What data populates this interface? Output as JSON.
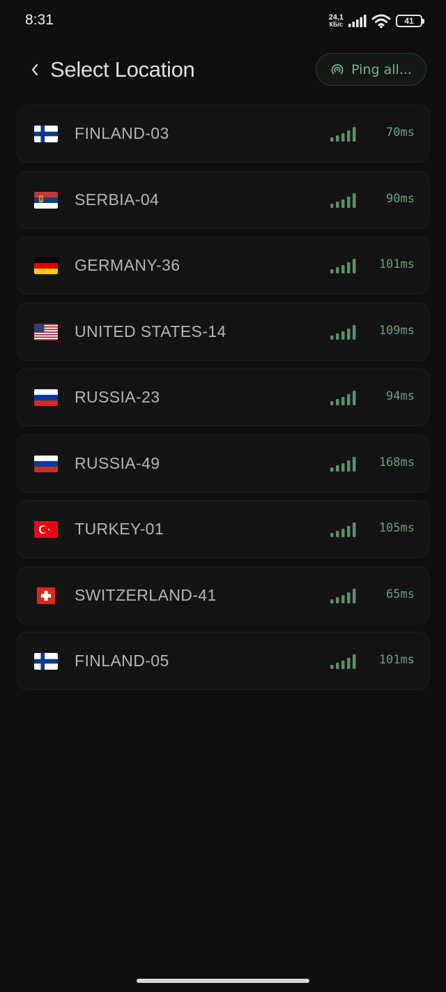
{
  "status_bar": {
    "time": "8:31",
    "net_speed_value": "24,1",
    "net_speed_unit": "КБ/с",
    "battery": "41",
    "icons": [
      "signal-icon",
      "wifi-icon",
      "battery-icon"
    ]
  },
  "header": {
    "title": "Select Location",
    "ping_all_label": "Ping all..."
  },
  "colors": {
    "background": "#0f0f0f",
    "row_background": "#141414",
    "accent_green": "#6f9e7c"
  },
  "locations": [
    {
      "name": "FINLAND-03",
      "ping": "70ms",
      "flag": "FI",
      "signal_bars": 5
    },
    {
      "name": "SERBIA-04",
      "ping": "90ms",
      "flag": "RS",
      "signal_bars": 5
    },
    {
      "name": "GERMANY-36",
      "ping": "101ms",
      "flag": "DE",
      "signal_bars": 5
    },
    {
      "name": "UNITED STATES-14",
      "ping": "109ms",
      "flag": "US",
      "signal_bars": 5
    },
    {
      "name": "RUSSIA-23",
      "ping": "94ms",
      "flag": "RU",
      "signal_bars": 5
    },
    {
      "name": "RUSSIA-49",
      "ping": "168ms",
      "flag": "RU",
      "signal_bars": 5
    },
    {
      "name": "TURKEY-01",
      "ping": "105ms",
      "flag": "TR",
      "signal_bars": 5
    },
    {
      "name": "SWITZERLAND-41",
      "ping": "65ms",
      "flag": "CH",
      "signal_bars": 5
    },
    {
      "name": "FINLAND-05",
      "ping": "101ms",
      "flag": "FI",
      "signal_bars": 5
    }
  ]
}
